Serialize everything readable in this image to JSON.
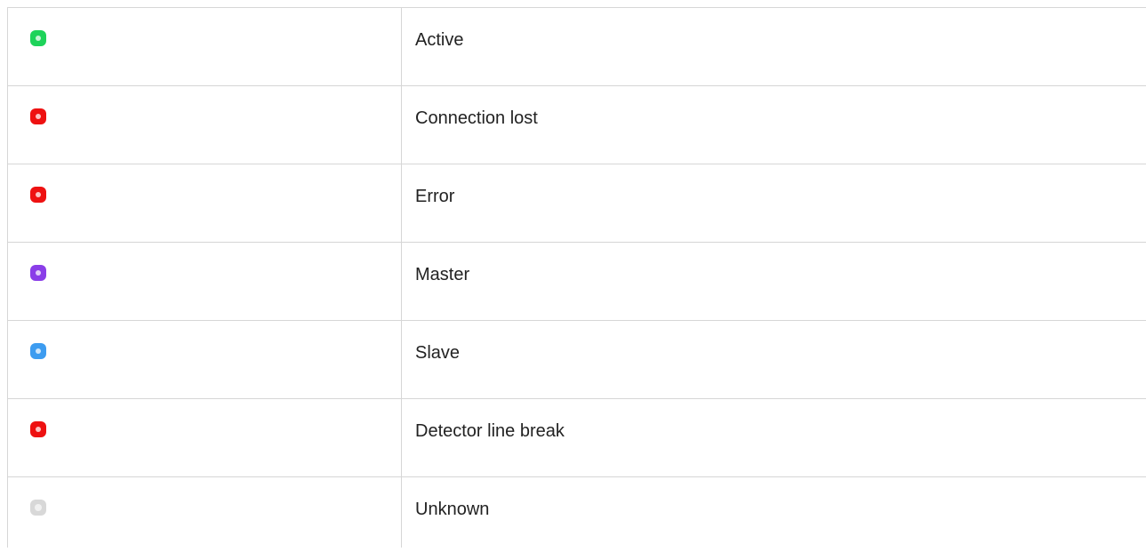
{
  "colors": {
    "green": "#1ed35a",
    "red": "#ee1111",
    "purple": "#8a3ee8",
    "blue": "#3d9cf0",
    "gray": "#d8d8d8"
  },
  "statuses": [
    {
      "label": "Active",
      "icon": "green-status-icon",
      "color": "#1ed35a"
    },
    {
      "label": "Connection lost",
      "icon": "red-status-icon",
      "color": "#ee1111"
    },
    {
      "label": "Error",
      "icon": "red-status-icon",
      "color": "#ee1111"
    },
    {
      "label": "Master",
      "icon": "purple-status-icon",
      "color": "#8a3ee8"
    },
    {
      "label": "Slave",
      "icon": "blue-status-icon",
      "color": "#3d9cf0"
    },
    {
      "label": "Detector line break",
      "icon": "red-status-icon",
      "color": "#ee1111"
    },
    {
      "label": "Unknown",
      "icon": "gray-status-icon",
      "color": "#d8d8d8"
    }
  ]
}
